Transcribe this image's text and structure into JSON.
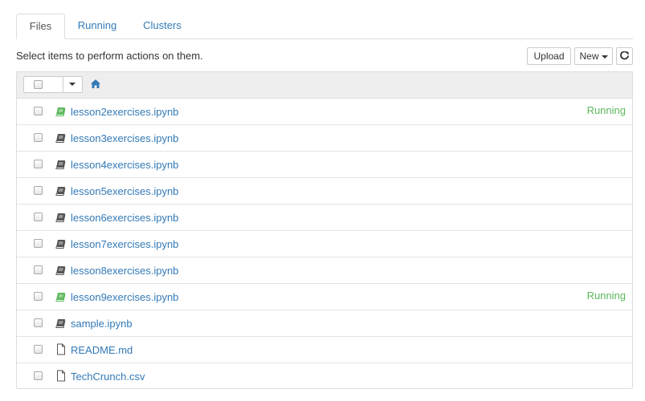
{
  "tabs": [
    {
      "label": "Files",
      "active": true
    },
    {
      "label": "Running",
      "active": false
    },
    {
      "label": "Clusters",
      "active": false
    }
  ],
  "toolbar": {
    "instruction": "Select items to perform actions on them.",
    "upload_label": "Upload",
    "new_label": "New",
    "refresh_icon": "refresh-icon"
  },
  "header": {
    "home_icon": "home-icon"
  },
  "colors": {
    "link": "#337ab7",
    "running": "#5cb85c",
    "notebook_running_icon": "#5cb85c",
    "notebook_icon": "#555555"
  },
  "files": [
    {
      "name": "lesson2exercises.ipynb",
      "type": "notebook",
      "status": "Running"
    },
    {
      "name": "lesson3exercises.ipynb",
      "type": "notebook",
      "status": ""
    },
    {
      "name": "lesson4exercises.ipynb",
      "type": "notebook",
      "status": ""
    },
    {
      "name": "lesson5exercises.ipynb",
      "type": "notebook",
      "status": ""
    },
    {
      "name": "lesson6exercises.ipynb",
      "type": "notebook",
      "status": ""
    },
    {
      "name": "lesson7exercises.ipynb",
      "type": "notebook",
      "status": ""
    },
    {
      "name": "lesson8exercises.ipynb",
      "type": "notebook",
      "status": ""
    },
    {
      "name": "lesson9exercises.ipynb",
      "type": "notebook",
      "status": "Running"
    },
    {
      "name": "sample.ipynb",
      "type": "notebook",
      "status": ""
    },
    {
      "name": "README.md",
      "type": "file",
      "status": ""
    },
    {
      "name": "TechCrunch.csv",
      "type": "file",
      "status": ""
    }
  ]
}
